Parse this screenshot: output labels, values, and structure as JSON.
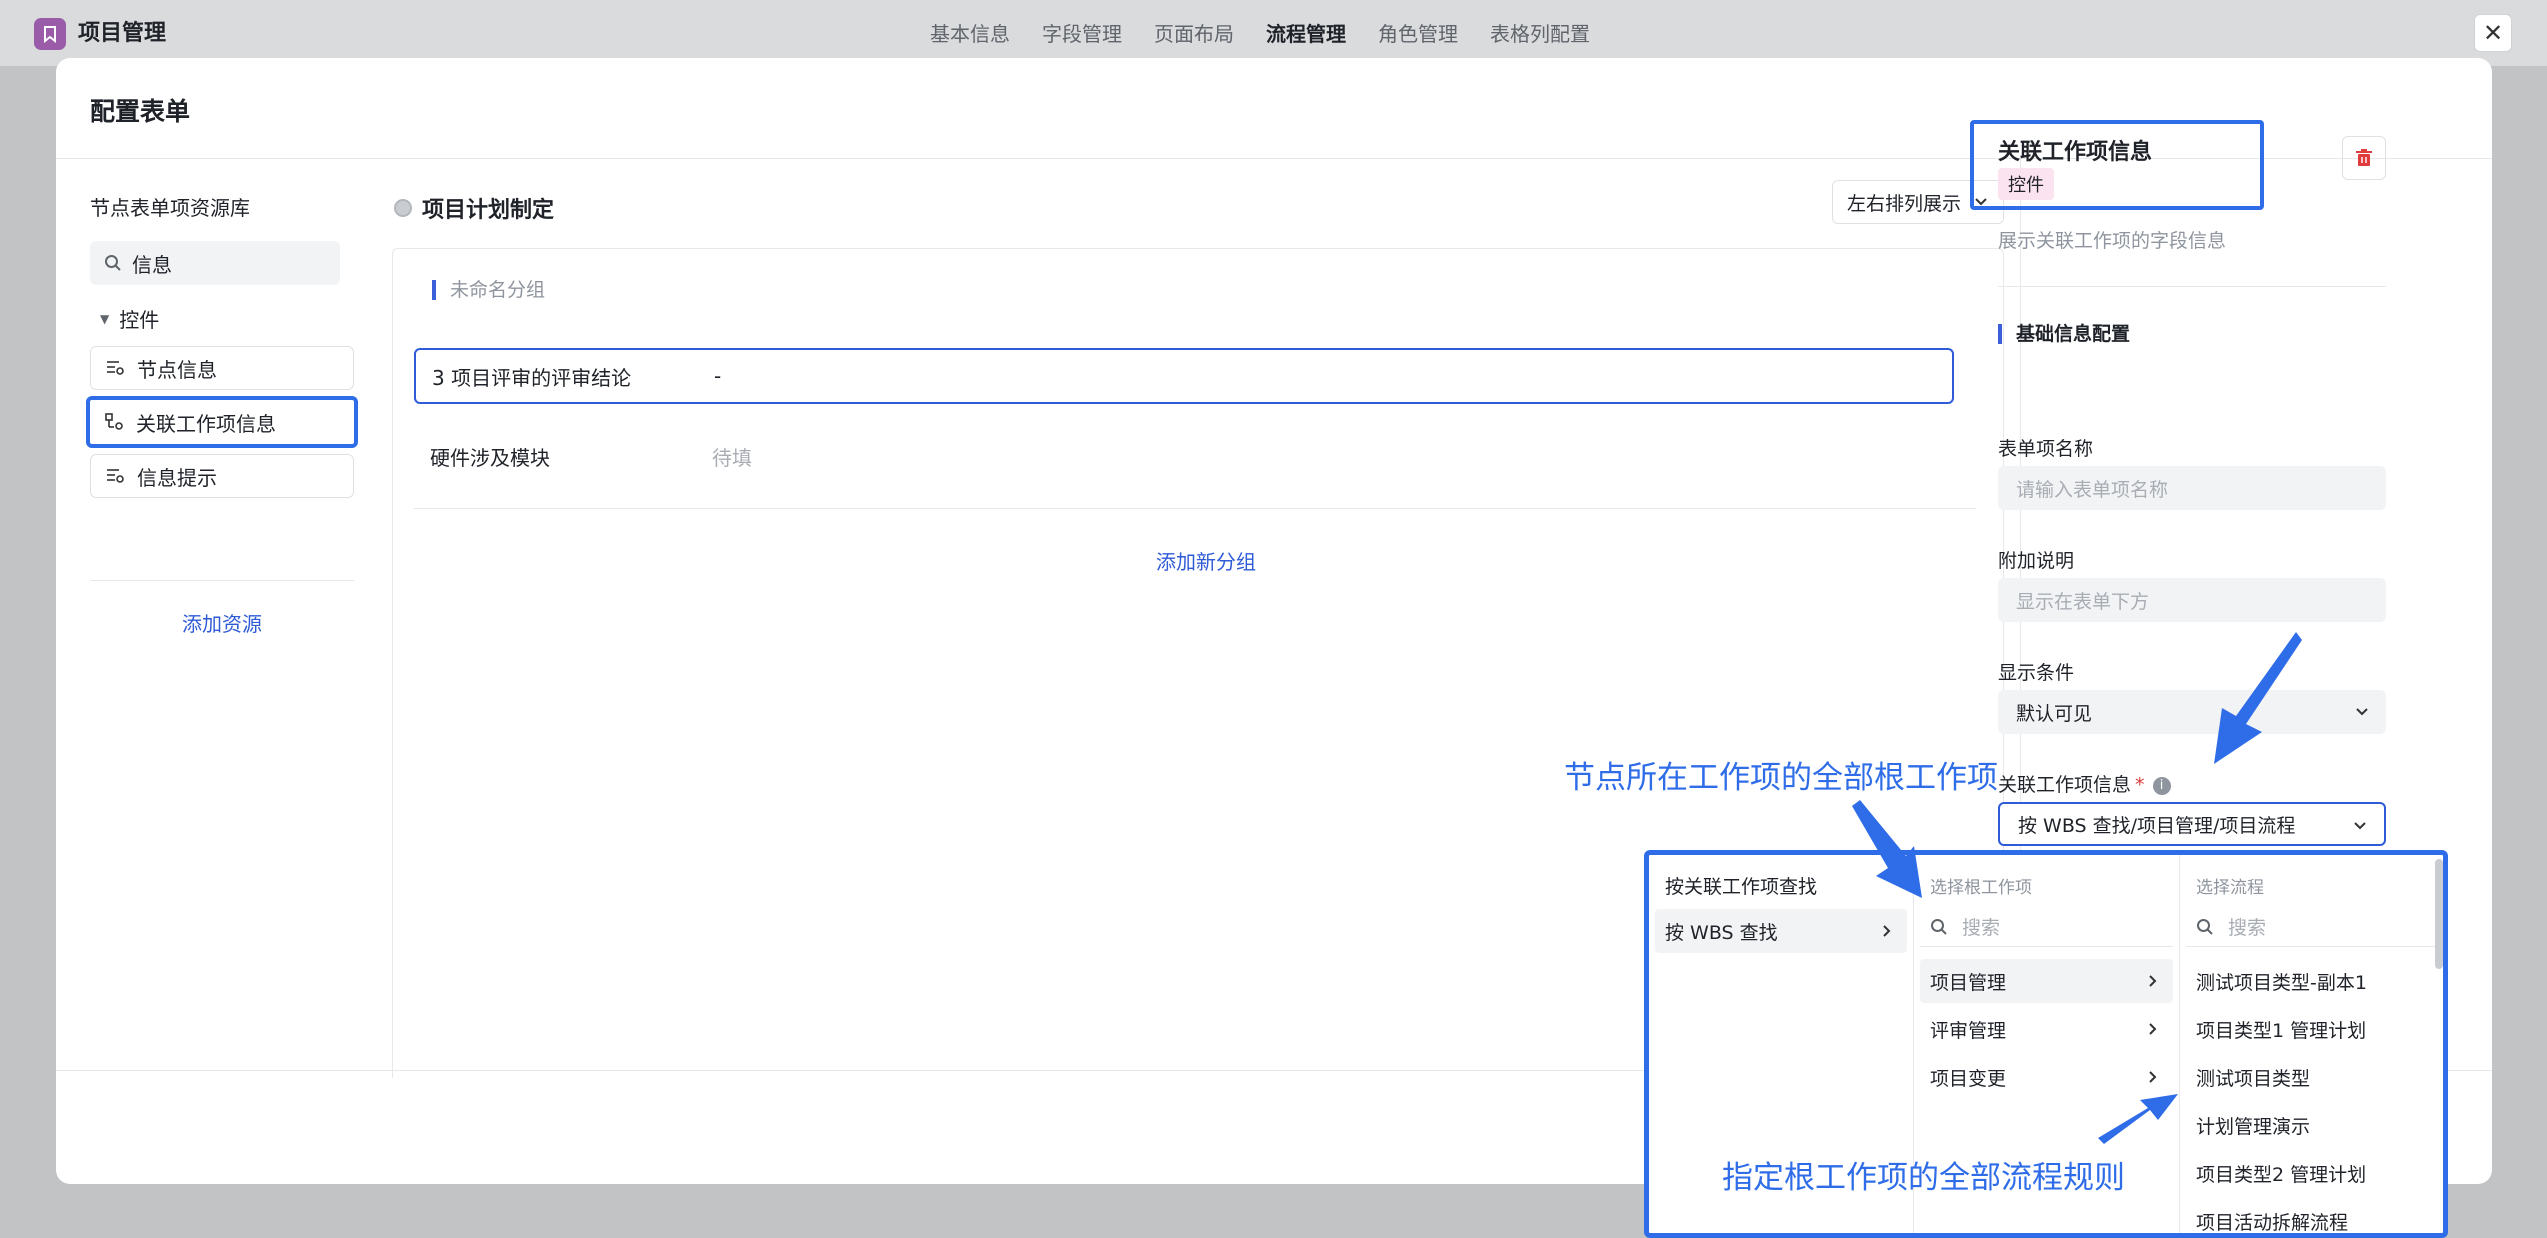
{
  "app": {
    "title": "项目管理",
    "tabs": [
      "基本信息",
      "字段管理",
      "页面布局",
      "流程管理",
      "角色管理",
      "表格列配置"
    ],
    "active_tab": "流程管理",
    "close_glyph": "✕"
  },
  "modal": {
    "title": "配置表单"
  },
  "library": {
    "title": "节点表单项资源库",
    "search_value": "信息",
    "tree_group": "控件",
    "items": [
      "节点信息",
      "关联工作项信息",
      "信息提示"
    ],
    "add_label": "添加资源"
  },
  "canvas": {
    "node_title": "项目计划制定",
    "layout_select": "左右排列展示",
    "group_label": "未命名分组",
    "rows": [
      {
        "label": "3 项目评审的评审结论",
        "value": "-"
      },
      {
        "label": "硬件涉及模块",
        "value": "待填"
      }
    ],
    "add_group_label": "添加新分组"
  },
  "props": {
    "title": "关联工作项信息",
    "tag": "控件",
    "description": "展示关联工作项的字段信息",
    "section": "基础信息配置",
    "name_label": "表单项名称",
    "name_placeholder": "请输入表单项名称",
    "note_label": "附加说明",
    "note_placeholder": "显示在表单下方",
    "condition_label": "显示条件",
    "condition_value": "默认可见",
    "link_label": "关联工作项信息",
    "required_mark": "*",
    "info_glyph": "i",
    "link_value": "按 WBS 查找/项目管理/项目流程"
  },
  "cascader": {
    "col1": [
      "按关联工作项查找",
      "按 WBS 查找"
    ],
    "col2_header": "选择根工作项",
    "col2_search": "搜索",
    "col2": [
      "项目管理",
      "评审管理",
      "项目变更"
    ],
    "col3_header": "选择流程",
    "col3_search": "搜索",
    "col3": [
      "测试项目类型-副本1",
      "项目类型1 管理计划",
      "测试项目类型",
      "计划管理演示",
      "项目类型2 管理计划",
      "项目活动拆解流程"
    ]
  },
  "annotations": {
    "top": "节点所在工作项的全部根工作项",
    "bottom": "指定根工作项的全部流程规则"
  },
  "colors": {
    "accent": "#2f6de8",
    "link": "#2f5bd6",
    "delete": "#e03b3b",
    "tag_bg": "#fbe3ef"
  }
}
